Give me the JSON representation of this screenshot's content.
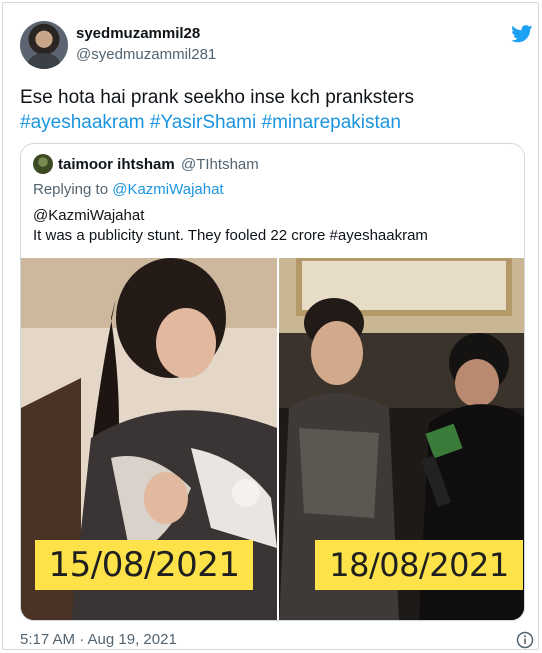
{
  "author": {
    "display_name": "syedmuzammil28",
    "handle": "@syedmuzammil281",
    "avatar_icon": "user-avatar"
  },
  "tweet": {
    "text": "Ese hota hai prank seekho inse kch pranksters",
    "hashtags": [
      "#ayeshaakram",
      "#YasirShami",
      "#minarepakistan"
    ],
    "timestamp": "5:17 AM · Aug 19, 2021"
  },
  "quoted_tweet": {
    "display_name": "taimoor ihtsham",
    "handle": "@TIhtsham",
    "replying_prefix": "Replying to",
    "replying_to": "@KazmiWajahat",
    "body_line1": "@KazmiWajahat",
    "body_line2": "It was a publicity stunt. They fooled 22 crore #ayeshaakram",
    "photos": {
      "left_date": "15/08/2021",
      "right_date": "18/08/2021",
      "label_color": "#fde24a"
    }
  },
  "icons": {
    "brand": "twitter-bird-icon",
    "info": "info-icon"
  },
  "colors": {
    "link": "#1b95e0",
    "secondary_text": "#536471",
    "brand": "#1da1f2"
  }
}
